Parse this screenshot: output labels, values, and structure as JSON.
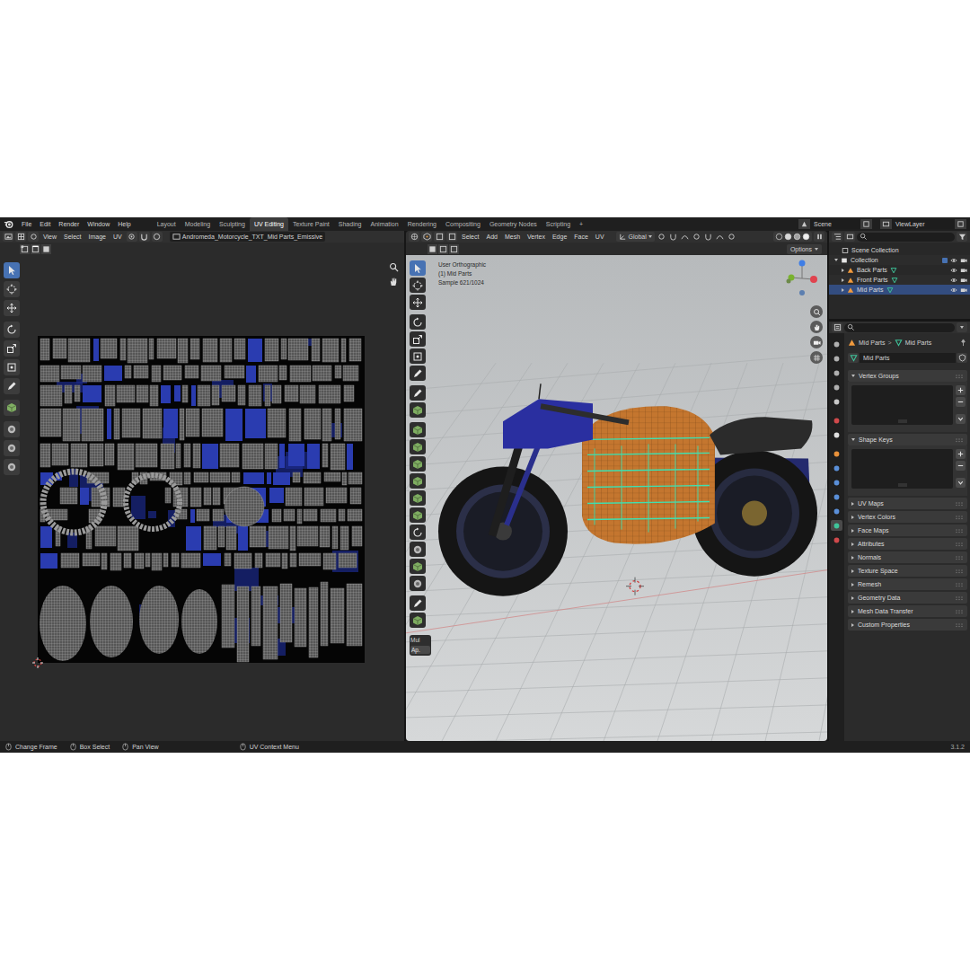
{
  "topbar": {
    "menus": [
      "File",
      "Edit",
      "Render",
      "Window",
      "Help"
    ],
    "workspaces": [
      {
        "label": "Layout",
        "selected": false
      },
      {
        "label": "Modeling",
        "selected": false
      },
      {
        "label": "Sculpting",
        "selected": false
      },
      {
        "label": "UV Editing",
        "selected": true
      },
      {
        "label": "Texture Paint",
        "selected": false
      },
      {
        "label": "Shading",
        "selected": false
      },
      {
        "label": "Animation",
        "selected": false
      },
      {
        "label": "Rendering",
        "selected": false
      },
      {
        "label": "Compositing",
        "selected": false
      },
      {
        "label": "Geometry Nodes",
        "selected": false
      },
      {
        "label": "Scripting",
        "selected": false
      }
    ],
    "add_workspace": "+",
    "scene": "Scene",
    "view_layer": "ViewLayer"
  },
  "uv_editor": {
    "menus": [
      "View",
      "Select",
      "Image",
      "UV"
    ],
    "image_name": "Andromeda_Motorcycle_TXT_Mid Parts_Emissive",
    "toolbar": [
      {
        "selected": true
      },
      {
        "selected": false
      },
      {
        "selected": false
      },
      {
        "selected": false
      },
      {
        "selected": false
      },
      {
        "selected": false
      },
      {
        "selected": false
      },
      {
        "selected": false
      },
      {
        "selected": false
      },
      {
        "selected": false
      },
      {
        "selected": false
      }
    ]
  },
  "viewport": {
    "menus": [
      "Select",
      "Add",
      "Mesh",
      "Vertex",
      "Edge",
      "Face",
      "UV"
    ],
    "transform_orientation": "Global",
    "options": "Options",
    "overlay_lines": [
      "User Orthographic",
      "(1) Mid Parts",
      "Sample 621/1024"
    ],
    "last_operator": {
      "title": "Mul",
      "button": "Ap."
    },
    "toolbar": [
      {
        "selected": true
      },
      {
        "selected": false
      },
      {
        "selected": false
      },
      {
        "selected": false
      },
      {
        "selected": false
      },
      {
        "selected": false
      },
      {
        "selected": false
      },
      {
        "selected": false
      },
      {
        "selected": false
      },
      {
        "selected": false
      },
      {
        "selected": false
      },
      {
        "selected": false
      },
      {
        "selected": false
      },
      {
        "selected": false
      },
      {
        "selected": false
      },
      {
        "selected": false
      },
      {
        "selected": false
      },
      {
        "selected": false
      },
      {
        "selected": false
      },
      {
        "selected": false
      },
      {
        "selected": false
      }
    ]
  },
  "outliner": {
    "root": "Scene Collection",
    "rows": [
      {
        "label": "Collection",
        "kind": "collection",
        "expanded": true,
        "selected": false
      },
      {
        "label": "Back Parts",
        "kind": "object",
        "expanded": false,
        "selected": false
      },
      {
        "label": "Front Parts",
        "kind": "object",
        "expanded": false,
        "selected": false
      },
      {
        "label": "Mid Parts",
        "kind": "object",
        "expanded": false,
        "selected": true
      }
    ]
  },
  "properties": {
    "breadcrumb": [
      "Mid Parts",
      "Mid Parts"
    ],
    "separator": ">",
    "mesh_name": "Mid Parts",
    "tabs": [
      {
        "selected": false
      },
      {
        "selected": false
      },
      {
        "selected": false
      },
      {
        "selected": false
      },
      {
        "selected": false
      },
      {
        "selected": false
      },
      {
        "selected": false
      },
      {
        "selected": false
      },
      {
        "selected": false
      },
      {
        "selected": false
      },
      {
        "selected": false
      },
      {
        "selected": false
      },
      {
        "selected": true
      },
      {
        "selected": false
      }
    ],
    "sections": [
      {
        "label": "Vertex Groups",
        "expanded": true
      },
      {
        "label": "Shape Keys",
        "expanded": true
      },
      {
        "label": "UV Maps",
        "expanded": false
      },
      {
        "label": "Vertex Colors",
        "expanded": false
      },
      {
        "label": "Face Maps",
        "expanded": false
      },
      {
        "label": "Attributes",
        "expanded": false
      },
      {
        "label": "Normals",
        "expanded": false
      },
      {
        "label": "Texture Space",
        "expanded": false
      },
      {
        "label": "Remesh",
        "expanded": false
      },
      {
        "label": "Geometry Data",
        "expanded": false
      },
      {
        "label": "Mesh Data Transfer",
        "expanded": false
      },
      {
        "label": "Custom Properties",
        "expanded": false
      }
    ]
  },
  "status_bar": {
    "items": [
      "Change Frame",
      "Box Select",
      "Pan View",
      "UV Context Menu"
    ],
    "version": "3.1.2"
  }
}
